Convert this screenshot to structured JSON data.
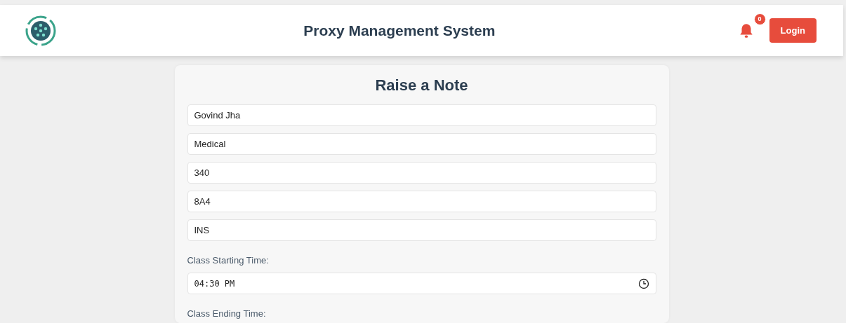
{
  "header": {
    "title": "Proxy Management System",
    "notifications": {
      "count": "0"
    },
    "login_button": "Login"
  },
  "form": {
    "title": "Raise a Note",
    "fields": [
      {
        "kind": "text",
        "value": "Govind Jha"
      },
      {
        "kind": "text",
        "value": "Medical"
      },
      {
        "kind": "text",
        "value": "340"
      },
      {
        "kind": "text",
        "value": "8A4"
      },
      {
        "kind": "text",
        "value": "INS"
      },
      {
        "kind": "time",
        "label": "Class Starting Time:",
        "value": "04:30 PM"
      },
      {
        "kind": "label",
        "label": "Class Ending Time:"
      }
    ]
  }
}
